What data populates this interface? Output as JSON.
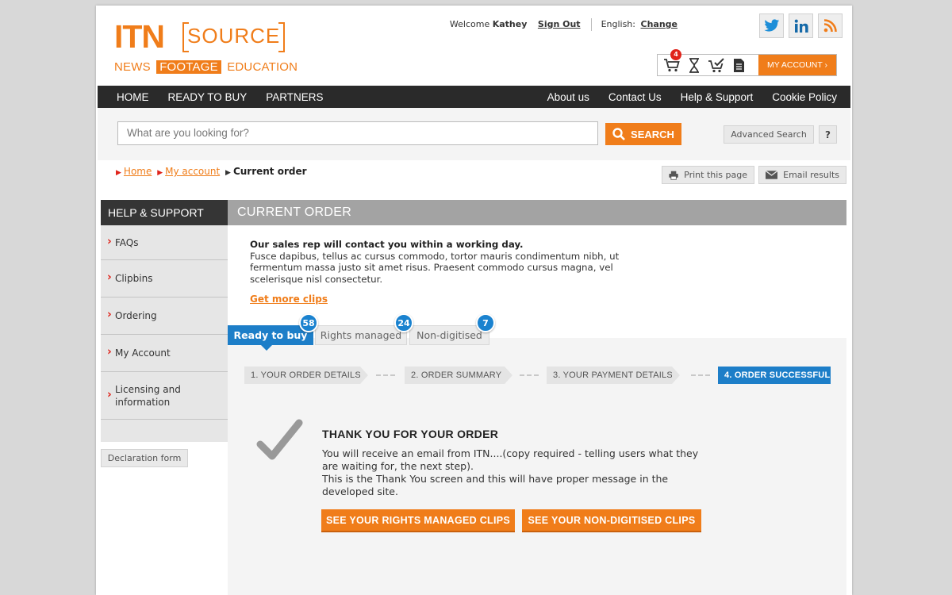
{
  "brand": {
    "logo_itn": "ITN",
    "logo_source": "SOURCE",
    "tagline_news": "NEWS",
    "tagline_footage": "FOOTAGE",
    "tagline_education": "EDUCATION",
    "accent_color": "#f07d1a",
    "blue_color": "#1d7ec8"
  },
  "topbar": {
    "welcome": "Welcome",
    "user": "Kathey",
    "sign_out": "Sign Out",
    "language": "English:",
    "change": "Change"
  },
  "social": {
    "twitter": "twitter-icon",
    "linkedin": "linkedin-icon",
    "rss": "rss-icon"
  },
  "cartbar": {
    "cart_count": "4",
    "my_account": "MY ACCOUNT ›"
  },
  "nav": {
    "left": [
      "HOME",
      "READY TO BUY",
      "PARTNERS"
    ],
    "right": [
      "About us",
      "Contact Us",
      "Help & Support",
      "Cookie Policy"
    ]
  },
  "search": {
    "placeholder": "What are you looking for?",
    "button": "SEARCH",
    "advanced": "Advanced Search",
    "help": "?"
  },
  "breadcrumb": {
    "home": "Home",
    "account": "My account",
    "current": "Current order"
  },
  "tools": {
    "print": "Print this page",
    "email": "Email results"
  },
  "sidebar": {
    "title": "HELP & SUPPORT",
    "items": [
      "FAQs",
      "Clipbins",
      "Ordering",
      "My Account",
      "Licensing and information"
    ],
    "declaration": "Declaration form"
  },
  "main": {
    "title": "CURRENT ORDER",
    "intro_lead": "Our sales rep will contact you within a working day.",
    "intro_body": "Fusce dapibus, tellus ac cursus commodo, tortor mauris condimentum nibh, ut fermentum massa justo sit amet risus. Praesent commodo cursus magna, vel scelerisque nisl consectetur.",
    "get_more": "Get more clips"
  },
  "tabs": [
    {
      "label": "Ready to buy",
      "count": "58"
    },
    {
      "label": "Rights managed",
      "count": "24"
    },
    {
      "label": "Non-digitised",
      "count": "7"
    }
  ],
  "steps": [
    "1. YOUR ORDER DETAILS",
    "2. ORDER SUMMARY",
    "3. YOUR PAYMENT DETAILS",
    "4. ORDER SUCCESSFUL"
  ],
  "thanks": {
    "title": "THANK YOU FOR YOUR ORDER",
    "line1": "You will receive an email from ITN....(copy required - telling users what they are waiting for, the next step).",
    "line2": "This is the Thank You screen and this will have proper message in the developed site.",
    "cta_rights": "SEE YOUR RIGHTS MANAGED CLIPS",
    "cta_nondigitised": "SEE YOUR NON-DIGITISED CLIPS"
  }
}
